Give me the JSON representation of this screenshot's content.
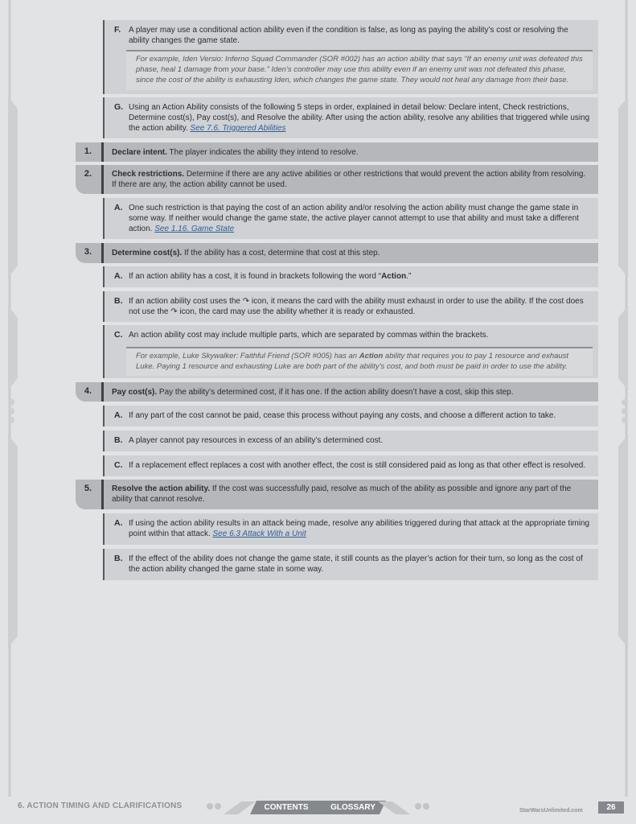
{
  "rules": {
    "F": {
      "label": "F.",
      "text": "A player may use a conditional action ability even if the condition is false, as long as paying the ability’s cost or resolving the ability changes the game state."
    },
    "F_example": "For example, Iden Versio: Inferno Squad Commander (SOR #002) has an action ability that says “If an enemy unit was defeated this phase, heal 1 damage from your base.” Iden’s controller may use this ability even if an enemy unit was not defeated this phase, since the cost of the ability is exhausting Iden, which changes the game state. They would not heal any damage from their base.",
    "G": {
      "label": "G.",
      "text": "Using an Action Ability consists of the following 5 steps in order, explained in detail below: Declare intent, Check restrictions, Determine cost(s), Pay cost(s), and Resolve the ability. After using the action ability, resolve any abilities that triggered while using the action ability. ",
      "link": "See 7.6. Triggered Abilities"
    },
    "step1": {
      "num": "1.",
      "title": "Declare intent.",
      "text": " The player indicates the ability they intend to resolve."
    },
    "step2": {
      "num": "2.",
      "title": "Check restrictions.",
      "text": " Determine if there are any active abilities or other restrictions that would prevent the action ability from resolving. If there are any, the action ability cannot be used."
    },
    "step2A": {
      "label": "A.",
      "text": "One such restriction is that paying the cost of an action ability and/or resolving the action ability must change the game state in some way. If neither would change the game state, the active player cannot attempt to use that ability and must take a different action. ",
      "link": "See 1.16. Game State"
    },
    "step3": {
      "num": "3.",
      "title": "Determine cost(s).",
      "text": " If the ability has a cost, determine that cost at this step."
    },
    "step3A": {
      "label": "A.",
      "text": "If an action ability has a cost, it is found in brackets following the word “",
      "bold": "Action",
      "tail": ".”"
    },
    "step3B": {
      "label": "B.",
      "text1": "If an action ability cost uses the ",
      "text2": " icon, it means the card with the ability must exhaust in order to use the ability. If the cost does not use the ",
      "text3": " icon, the card may use the ability whether it is ready or exhausted."
    },
    "step3C": {
      "label": "C.",
      "text": "An action ability cost may include multiple parts, which are separated by commas within the brackets."
    },
    "step3C_example": {
      "pre": "For example, Luke Skywalker: Faithful Friend (SOR #005) has an ",
      "bold": "Action",
      "post": " ability that requires you to pay 1 resource and exhaust Luke. Paying 1 resource and exhausting Luke are both part of the ability’s cost, and both must be paid in order to use the ability."
    },
    "step4": {
      "num": "4.",
      "title": "Pay cost(s).",
      "text": " Pay the ability’s determined cost, if it has one. If the action ability doesn’t have a cost, skip this step."
    },
    "step4A": {
      "label": "A.",
      "text": "If any part of the cost cannot be paid, cease this process without paying any costs, and choose a different action to take."
    },
    "step4B": {
      "label": "B.",
      "text": "A player cannot pay resources in excess of an ability’s determined cost."
    },
    "step4C": {
      "label": "C.",
      "text": "If a replacement effect replaces a cost with another effect, the cost is still considered paid as long as that other effect is resolved."
    },
    "step5": {
      "num": "5.",
      "title": "Resolve the action ability.",
      "text": " If the cost was successfully paid, resolve as much of the ability as possible and ignore any part of the ability that cannot resolve."
    },
    "step5A": {
      "label": "A.",
      "text": "If using the action ability results in an attack being made, resolve any abilities triggered during that attack at the appropriate timing point within that attack. ",
      "link": "See 6.3 Attack With a Unit"
    },
    "step5B": {
      "label": "B.",
      "text": "If the effect of the ability does not change the game state, it still counts as the player’s action for their turn, so long as the cost of the action ability changed the game state in some way."
    }
  },
  "footer": {
    "section": "6. ACTION TIMING AND CLARIFICATIONS",
    "contents": "CONTENTS",
    "glossary": "GLOSSARY",
    "site": "StarWarsUnlimited.com",
    "page": "26"
  },
  "icons": {
    "exhaust": "exhaust-icon"
  },
  "colors": {
    "link": "#2f5f96",
    "block": "#cfd1d4",
    "step": "#b5b7ba"
  }
}
